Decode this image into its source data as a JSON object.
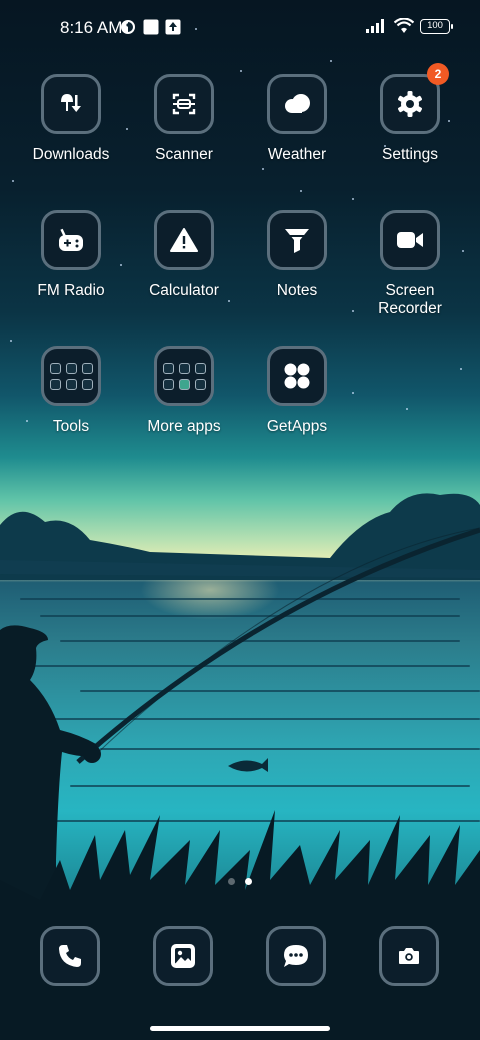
{
  "status_bar": {
    "time": "8:16 AM",
    "battery": "100",
    "icons": [
      "data-saver-icon",
      "square-notification-icon",
      "upload-notification-icon",
      "signal-icon",
      "wifi-icon",
      "battery-icon"
    ]
  },
  "apps": [
    {
      "label": "Downloads",
      "icon": "downloads-icon"
    },
    {
      "label": "Scanner",
      "icon": "scanner-icon"
    },
    {
      "label": "Weather",
      "icon": "cloud-icon"
    },
    {
      "label": "Settings",
      "icon": "gear-icon",
      "badge": "2"
    },
    {
      "label": "FM Radio",
      "icon": "radio-icon"
    },
    {
      "label": "Calculator",
      "icon": "warning-triangle-icon"
    },
    {
      "label": "Notes",
      "icon": "funnel-icon"
    },
    {
      "label": "Screen Recorder",
      "icon": "video-camera-icon"
    },
    {
      "label": "Tools",
      "icon": "folder-icon"
    },
    {
      "label": "More apps",
      "icon": "folder-icon"
    },
    {
      "label": "GetApps",
      "icon": "four-dots-icon"
    }
  ],
  "dock": [
    {
      "name": "phone",
      "icon": "phone-icon"
    },
    {
      "name": "gallery",
      "icon": "gallery-icon"
    },
    {
      "name": "messages",
      "icon": "chat-bubble-icon"
    },
    {
      "name": "camera",
      "icon": "camera-icon"
    }
  ],
  "pager": {
    "pages": 2,
    "current": 2
  },
  "colors": {
    "badge": "#f15a24",
    "tile_background": "#0c1e2b",
    "tile_border": "#5b6f7d",
    "sky_top": "#061622",
    "horizon": "#f2f0b8",
    "water": "#27b5c2"
  }
}
